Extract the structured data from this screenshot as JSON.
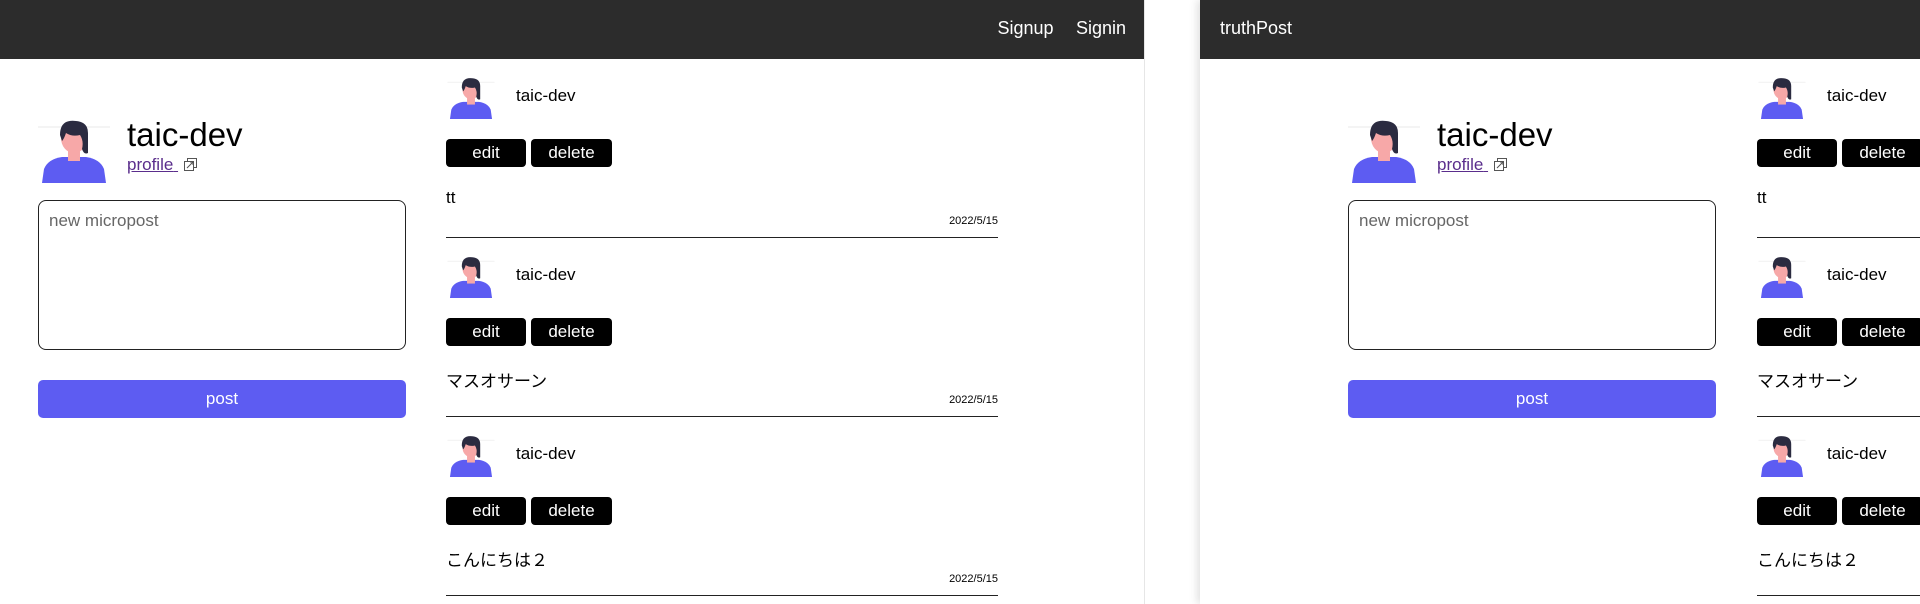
{
  "left": {
    "nav": {
      "links": [
        "Signup",
        "Signin"
      ]
    },
    "profile": {
      "username": "taic-dev",
      "link_label": "profile"
    },
    "composer": {
      "placeholder": "new micropost",
      "value": ""
    },
    "post_button": "post",
    "posts": [
      {
        "user": "taic-dev",
        "edit": "edit",
        "delete": "delete",
        "body": "tt",
        "date": "2022/5/15"
      },
      {
        "user": "taic-dev",
        "edit": "edit",
        "delete": "delete",
        "body": "マスオサーン",
        "date": "2022/5/15"
      },
      {
        "user": "taic-dev",
        "edit": "edit",
        "delete": "delete",
        "body": "こんにちは２",
        "date": "2022/5/15"
      }
    ]
  },
  "right": {
    "nav": {
      "brand": "truthPost"
    },
    "profile": {
      "username": "taic-dev",
      "link_label": "profile"
    },
    "composer": {
      "placeholder": "new micropost",
      "value": ""
    },
    "post_button": "post",
    "posts": [
      {
        "user": "taic-dev",
        "edit": "edit",
        "delete": "delete",
        "body": "tt"
      },
      {
        "user": "taic-dev",
        "edit": "edit",
        "delete": "delete",
        "body": "マスオサーン"
      },
      {
        "user": "taic-dev",
        "edit": "edit",
        "delete": "delete",
        "body": "こんにちは２"
      }
    ]
  },
  "colors": {
    "navbar": "#2c2c2c",
    "accent": "#5d5cf2",
    "button": "#000000",
    "link": "#5a2d8c"
  },
  "icons": {
    "avatar": "person-avatar-icon",
    "external": "external-link-icon"
  }
}
